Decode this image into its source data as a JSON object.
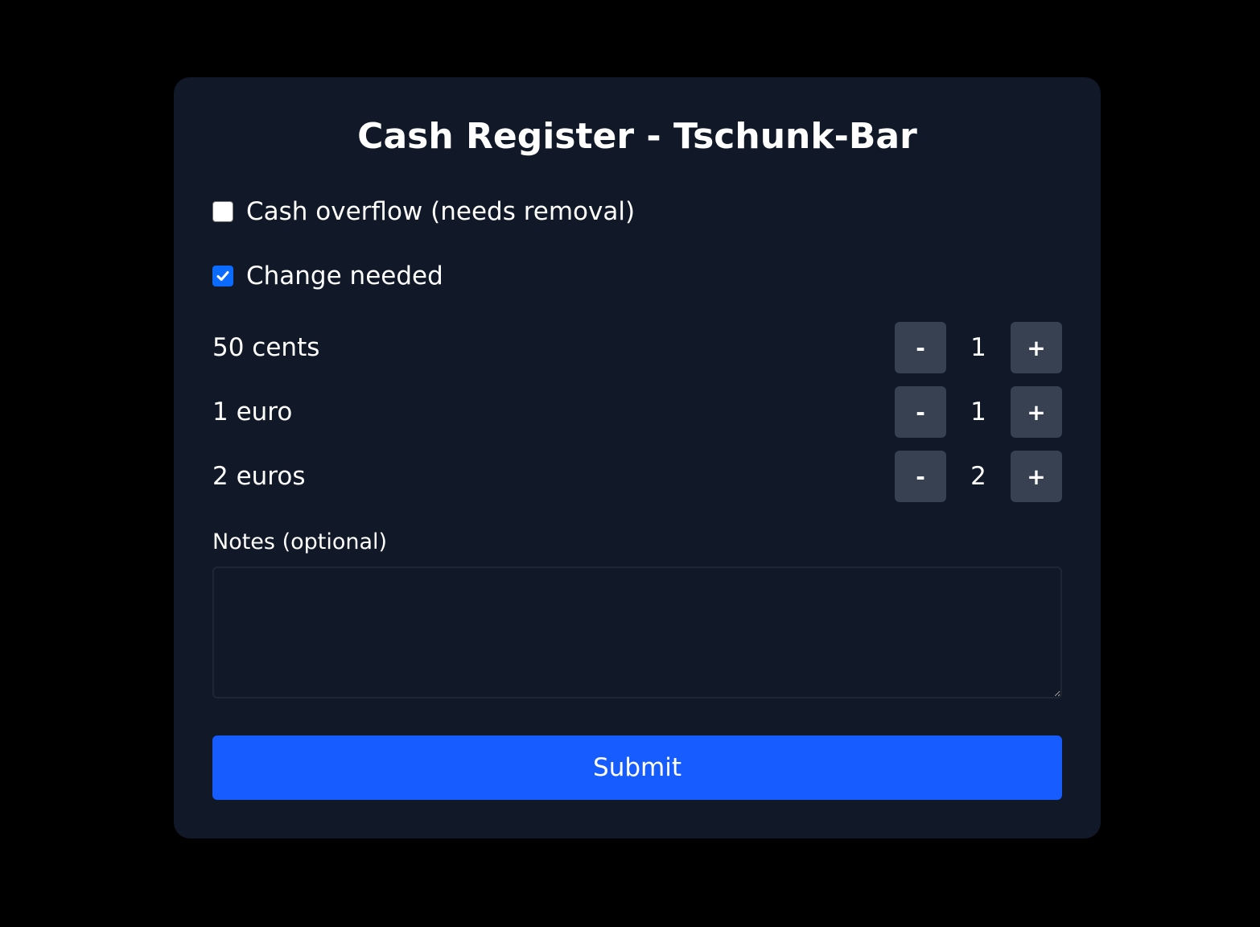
{
  "form": {
    "title": "Cash Register - Tschunk-Bar",
    "options": [
      {
        "label": "Cash overflow (needs removal)",
        "checked": false
      },
      {
        "label": "Change needed",
        "checked": true
      }
    ],
    "coins": [
      {
        "label": "50 cents",
        "count": "1"
      },
      {
        "label": "1 euro",
        "count": "1"
      },
      {
        "label": "2 euros",
        "count": "2"
      }
    ],
    "stepper": {
      "minus_label": "-",
      "plus_label": "+"
    },
    "notes": {
      "label": "Notes (optional)",
      "value": "",
      "placeholder": ""
    },
    "submit_label": "Submit"
  },
  "colors": {
    "background": "#000000",
    "card": "#111827",
    "stepper_button": "#374151",
    "accent": "#175cff",
    "checkbox_checked": "#0b6bff"
  }
}
